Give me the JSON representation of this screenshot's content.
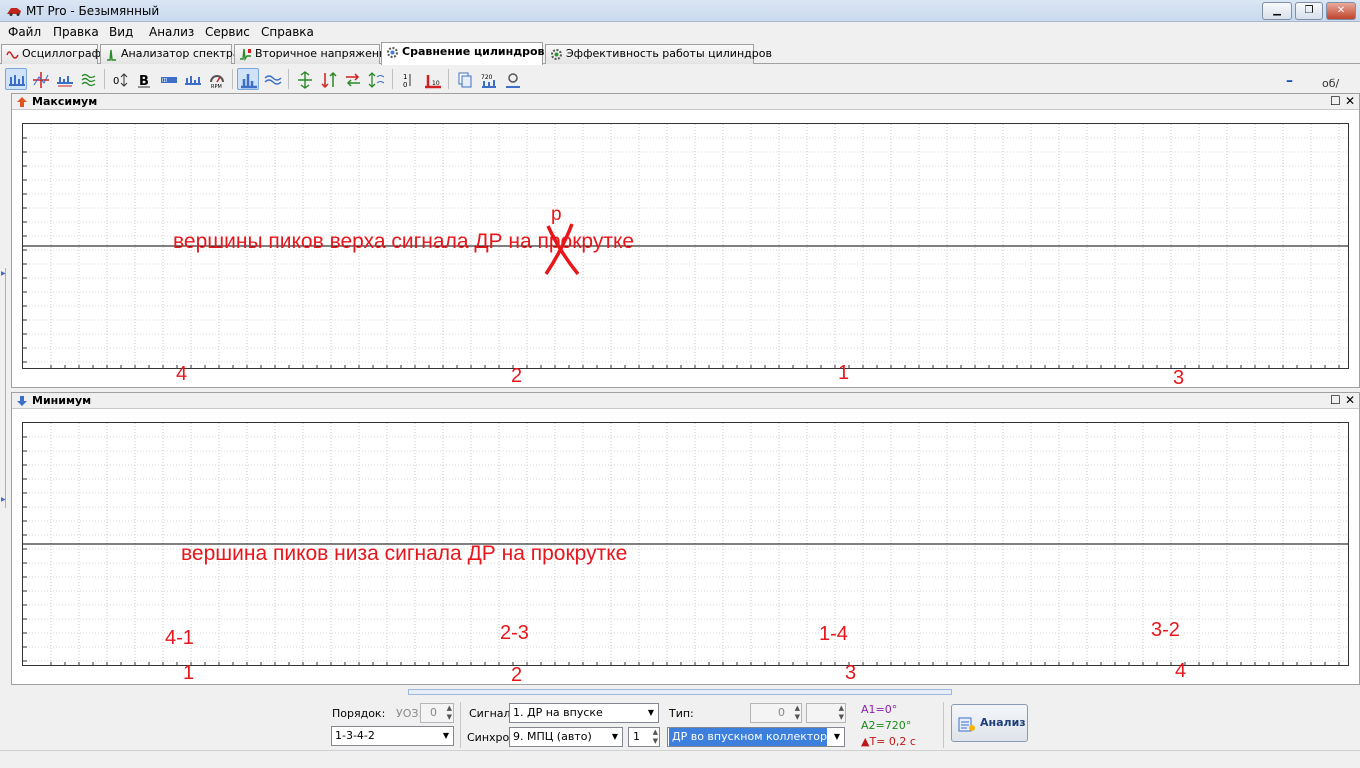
{
  "window": {
    "title": "MT Pro - Безымянный"
  },
  "menu": [
    "Файл",
    "Правка",
    "Вид",
    "Анализ",
    "Сервис",
    "Справка"
  ],
  "tabs": [
    {
      "label": "Осциллограф",
      "icon": "oscilloscope-icon"
    },
    {
      "label": "Анализатор спектра",
      "icon": "spectrum-icon"
    },
    {
      "label": "Вторичное напряжение",
      "icon": "secondary-voltage-icon"
    },
    {
      "label": "Сравнение цилиндров",
      "icon": "gear-icon",
      "active": true
    },
    {
      "label": "Эффективность работы цилиндров",
      "icon": "efficiency-icon"
    }
  ],
  "toolbar": {
    "rpm_value": "–",
    "rpm_unit": "об/мин"
  },
  "panels": {
    "max": {
      "title": "Максимум",
      "icon": "arrow-up-icon"
    },
    "min": {
      "title": "Минимум",
      "icon": "arrow-down-icon"
    }
  },
  "annotations": {
    "max_text": "вершины пиков верха сигнала ДР на прокрутке",
    "max_correction": "р",
    "max_cyl": [
      "4",
      "2",
      "1",
      "3"
    ],
    "min_text": "вершина пиков низа сигнала ДР на прокрутке",
    "min_pairs": [
      "4-1",
      "2-3",
      "1-4",
      "3-2"
    ],
    "min_cyl": [
      "1",
      "2",
      "3",
      "4"
    ]
  },
  "bottom": {
    "order_label": "Порядок:",
    "order_value": "1-3-4-2",
    "uoz_label": "УОЗ:",
    "uoz_value": "0",
    "signal_label": "Сигнал:",
    "signal_value": "1. ДР на впуске",
    "sync_label": "Синхро:",
    "sync_value": "9. МПЦ (авто)",
    "sync_num": "1",
    "type_label": "Тип:",
    "type_spin": "0",
    "type_value": "ДР во впускном коллекторе",
    "a1": "A1=0°",
    "a2": "A2=720°",
    "dt": "▲T= 0,2 с",
    "analyze_label": "Анализ"
  },
  "colors": {
    "accent": "#3d7fdc",
    "annotation": "#e8161b",
    "a1": "#8a1fb0",
    "a2": "#1c8a1c",
    "dt": "#c01818"
  }
}
